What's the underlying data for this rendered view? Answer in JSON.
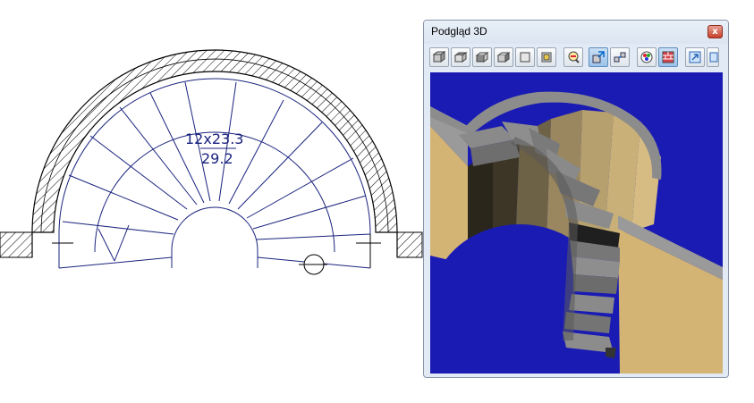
{
  "cad": {
    "dimension": {
      "count_size": "12x23.3",
      "tread": "29.2"
    }
  },
  "window": {
    "title": "Podgląd 3D",
    "close_symbol": "x"
  },
  "toolbar": {
    "buttons": [
      {
        "name": "view-front-icon",
        "active": false
      },
      {
        "name": "view-top-icon",
        "active": false
      },
      {
        "name": "view-left-icon",
        "active": false
      },
      {
        "name": "view-right-icon",
        "active": false
      },
      {
        "name": "view-back-icon",
        "active": false
      },
      {
        "name": "view-bottom-icon",
        "active": false
      },
      {
        "name": "zoom-icon",
        "active": false
      },
      {
        "name": "rotate-icon",
        "active": true
      },
      {
        "name": "pan-icon",
        "active": false
      },
      {
        "name": "render-mode-icon",
        "active": false
      },
      {
        "name": "texture-icon",
        "active": true
      },
      {
        "name": "export-icon",
        "active": false
      }
    ]
  },
  "colors": {
    "plan_line": "#1a237e",
    "background_3d": "#1a1bb3",
    "wall": "#d7b978",
    "step": "#8a8a8a"
  }
}
